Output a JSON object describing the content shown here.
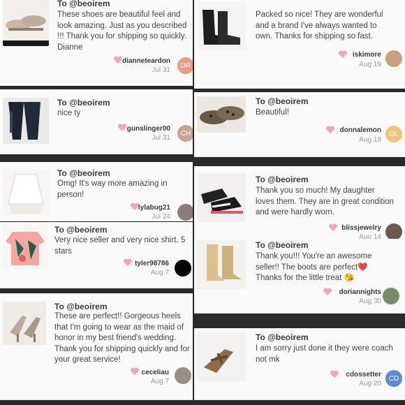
{
  "colors": {
    "heart": "#f3a7b4",
    "avatar_dr": "#ea9a82",
    "avatar_ch": "#c9a494",
    "avatar_dl": "#f0c27a",
    "avatar_cd": "#5b8bd6"
  },
  "reviews": [
    {
      "to": "To @beoirem",
      "message": "These shoes are beautiful feel and look amazing. Just as you described !!! Thank you for shipping so quickly. Dianne",
      "username": "dianneteardon",
      "date": "Jul 31",
      "avatar_initials": "DR",
      "thumb_icon": "tan-shoes-photo"
    },
    {
      "to": "To @beoirem",
      "message": "nice ty",
      "username": "gunslinger00",
      "date": "Jul 31",
      "avatar_initials": "CH",
      "thumb_icon": "black-jeans-photo"
    },
    {
      "to": "To @beoirem",
      "message": "Omg! It's way more amazing in person!",
      "username": "lylabug21",
      "date": "Jul 24",
      "avatar_initials": "",
      "thumb_icon": "white-top-photo"
    },
    {
      "to": "To @beoirem",
      "message": "Very nice seller and very nice shirt. 5 stars",
      "username": "tyler98786",
      "date": "Aug 7",
      "avatar_initials": "",
      "thumb_icon": "floral-shirt-photo"
    },
    {
      "to": "To @beoirem",
      "message": "These are perfect!! Gorgeous heels that I'm going to wear as the maid of honor in my best friend's wedding. Thank you for shipping quickly and for your great service!",
      "username": "ceceliau",
      "date": "Aug 7",
      "avatar_initials": "",
      "thumb_icon": "heels-photo"
    },
    {
      "to": "",
      "message": "Packed so nice! They are wonderful and a brand I've always wanted to own. Thanks for shipping so fast.",
      "username": "iskimore",
      "date": "Aug 19",
      "avatar_initials": "",
      "thumb_icon": "black-booties-photo"
    },
    {
      "to": "To @beoirem",
      "message": "Beautiful!",
      "username": "donnalemon",
      "date": "Aug 18",
      "avatar_initials": "DL",
      "thumb_icon": "leopard-flats-photo"
    },
    {
      "to": "To @beoirem",
      "message": "Thank you so much! My daughter loves them. They are in great condition and were hardly worn.",
      "username": "blissjewelry",
      "date": "Aug 14",
      "avatar_initials": "",
      "thumb_icon": "sneakers-photo"
    },
    {
      "to": "To @beoirem",
      "message": "Thank you!!! You're an awesome seller!! The boots are perfect❤️ Thanks for the little treat 😘",
      "username": "doriannights",
      "date": "Aug 30",
      "avatar_initials": "",
      "thumb_icon": "gold-boots-photo"
    },
    {
      "to": "To @beoirem",
      "message": "I am sorry just done it they were coach not mk",
      "username": "cdossetter",
      "date": "Aug 20",
      "avatar_initials": "CD",
      "thumb_icon": "sandal-wedge-photo"
    }
  ]
}
